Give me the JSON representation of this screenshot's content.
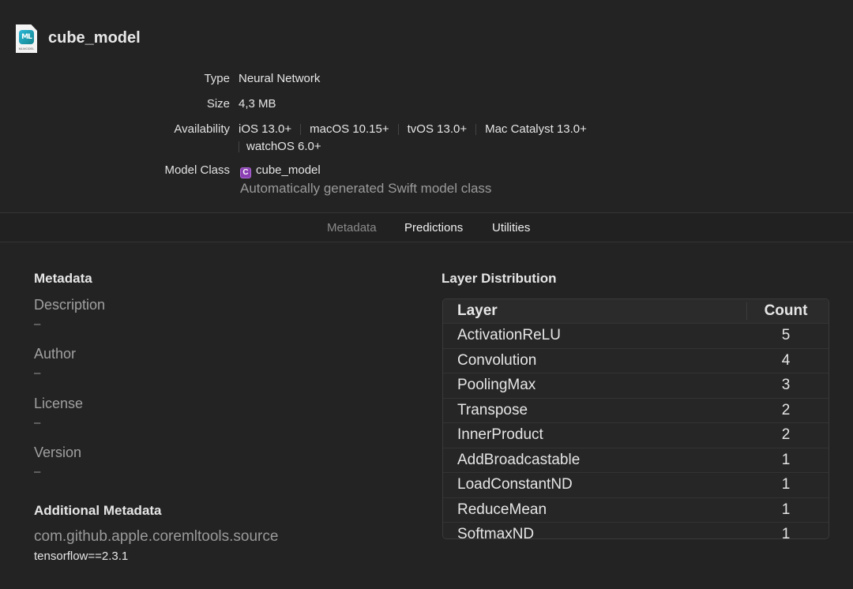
{
  "header": {
    "file_icon": "mlmodel-file-icon",
    "file_icon_badge": "ML",
    "file_icon_caption": "MLMODEL",
    "title": "cube_model"
  },
  "info": {
    "type_label": "Type",
    "type_value": "Neural Network",
    "size_label": "Size",
    "size_value": "4,3 MB",
    "availability_label": "Availability",
    "availability": [
      "iOS 13.0+",
      "macOS 10.15+",
      "tvOS 13.0+",
      "Mac Catalyst 13.0+",
      "watchOS 6.0+"
    ],
    "model_class_label": "Model Class",
    "model_class_icon": "C",
    "model_class_value": "cube_model",
    "model_class_description": "Automatically generated Swift model class"
  },
  "tabs": [
    {
      "label": "Metadata",
      "active": true
    },
    {
      "label": "Predictions",
      "active": false
    },
    {
      "label": "Utilities",
      "active": false
    }
  ],
  "metadata": {
    "heading": "Metadata",
    "fields": [
      {
        "key": "Description",
        "value": "–"
      },
      {
        "key": "Author",
        "value": "–"
      },
      {
        "key": "License",
        "value": "–"
      },
      {
        "key": "Version",
        "value": "–"
      }
    ]
  },
  "additional_metadata": {
    "heading": "Additional Metadata",
    "key": "com.github.apple.coremltools.source",
    "value": "tensorflow==2.3.1"
  },
  "layer_distribution": {
    "heading": "Layer Distribution",
    "columns": [
      "Layer",
      "Count"
    ],
    "rows": [
      {
        "layer": "ActivationReLU",
        "count": "5"
      },
      {
        "layer": "Convolution",
        "count": "4"
      },
      {
        "layer": "PoolingMax",
        "count": "3"
      },
      {
        "layer": "Transpose",
        "count": "2"
      },
      {
        "layer": "InnerProduct",
        "count": "2"
      },
      {
        "layer": "AddBroadcastable",
        "count": "1"
      },
      {
        "layer": "LoadConstantND",
        "count": "1"
      },
      {
        "layer": "ReduceMean",
        "count": "1"
      },
      {
        "layer": "SoftmaxND",
        "count": "1"
      }
    ]
  }
}
